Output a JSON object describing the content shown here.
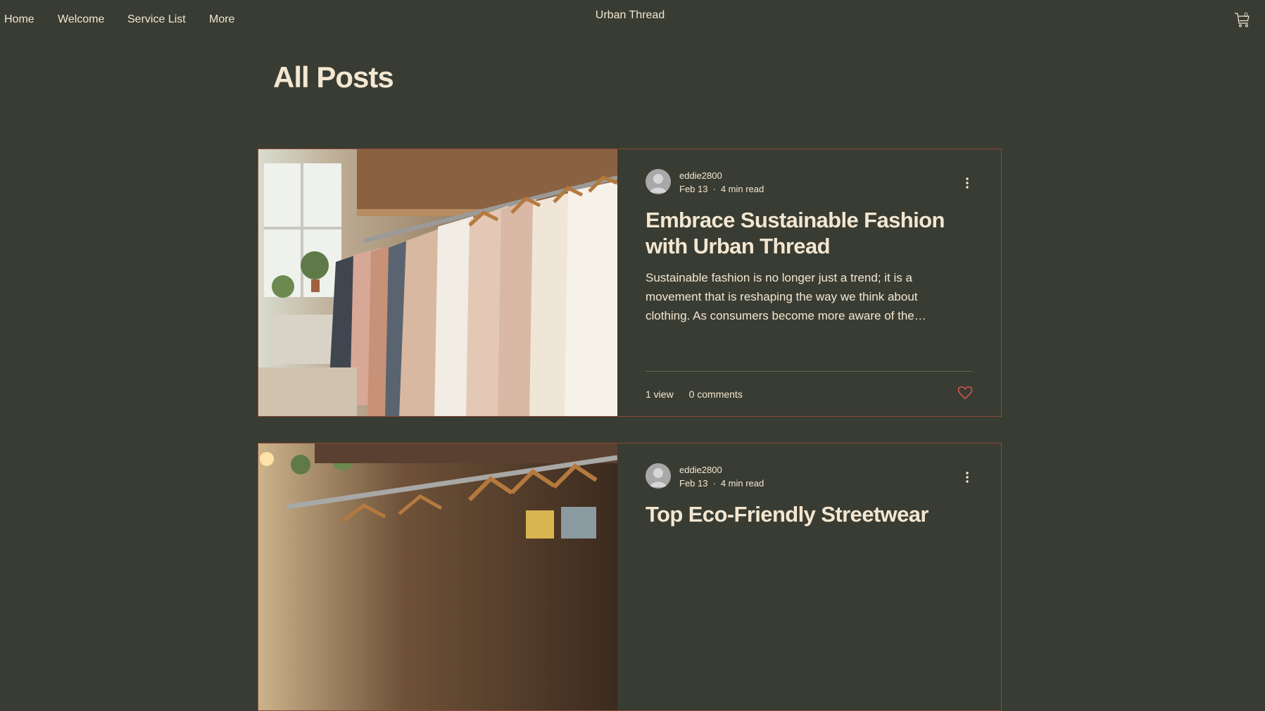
{
  "nav": {
    "items": [
      "Home",
      "Welcome",
      "Service List",
      "More"
    ],
    "site_title": "Urban Thread",
    "cart_count": "0"
  },
  "page": {
    "title": "All Posts"
  },
  "posts": [
    {
      "author": "eddie2800",
      "date": "Feb 13",
      "separator": "·",
      "read_time": "4 min read",
      "title": "Embrace Sustainable Fashion with Urban Thread",
      "excerpt": "Sustainable fashion is no longer just a trend; it is a movement that is reshaping the way we think about clothing. As consumers become more aware of the…",
      "views": "1 view",
      "comments": "0 comments"
    },
    {
      "author": "eddie2800",
      "date": "Feb 13",
      "separator": "·",
      "read_time": "4 min read",
      "title": "Top Eco-Friendly Streetwear"
    }
  ],
  "colors": {
    "background": "#393c32",
    "text": "#f3e7d2",
    "card_border": "#8b4a36",
    "like_heart": "#d9534f"
  },
  "icons": [
    "cart-icon",
    "avatar-icon",
    "more-options-icon",
    "heart-icon"
  ]
}
